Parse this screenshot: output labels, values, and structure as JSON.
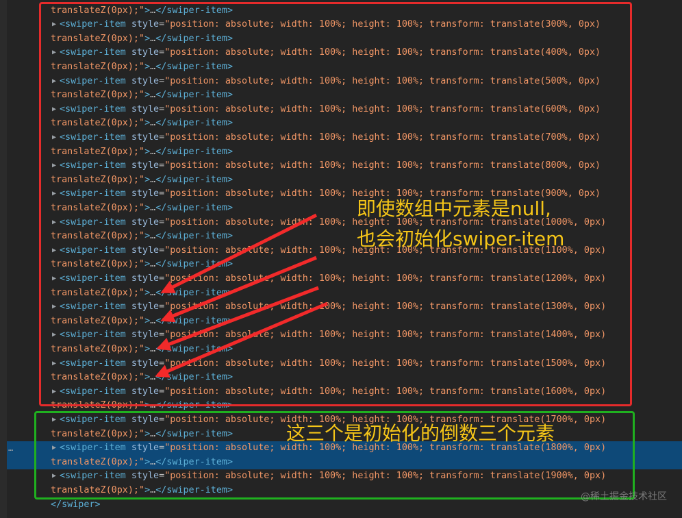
{
  "lines": [
    {
      "kind": "cont",
      "text": "translateZ(0px);\">…</swiper-item>"
    },
    {
      "kind": "open",
      "pct": "300%"
    },
    {
      "kind": "cont",
      "text": "translateZ(0px);\">…</swiper-item>"
    },
    {
      "kind": "open",
      "pct": "400%"
    },
    {
      "kind": "cont",
      "text": "translateZ(0px);\">…</swiper-item>"
    },
    {
      "kind": "open",
      "pct": "500%"
    },
    {
      "kind": "cont",
      "text": "translateZ(0px);\">…</swiper-item>"
    },
    {
      "kind": "open",
      "pct": "600%"
    },
    {
      "kind": "cont",
      "text": "translateZ(0px);\">…</swiper-item>"
    },
    {
      "kind": "open",
      "pct": "700%"
    },
    {
      "kind": "cont",
      "text": "translateZ(0px);\">…</swiper-item>"
    },
    {
      "kind": "open",
      "pct": "800%"
    },
    {
      "kind": "cont",
      "text": "translateZ(0px);\">…</swiper-item>"
    },
    {
      "kind": "open",
      "pct": "900%"
    },
    {
      "kind": "cont",
      "text": "translateZ(0px);\">…</swiper-item>"
    },
    {
      "kind": "open",
      "pct": "1000%"
    },
    {
      "kind": "cont",
      "text": "translateZ(0px);\">…</swiper-item>"
    },
    {
      "kind": "open",
      "pct": "1100%"
    },
    {
      "kind": "cont",
      "text": "translateZ(0px);\">…</swiper-item>"
    },
    {
      "kind": "open",
      "pct": "1200%"
    },
    {
      "kind": "cont",
      "text": "translateZ(0px);\">…</swiper-item>"
    },
    {
      "kind": "open",
      "pct": "1300%"
    },
    {
      "kind": "cont",
      "text": "translateZ(0px);\">…</swiper-item>"
    },
    {
      "kind": "open",
      "pct": "1400%"
    },
    {
      "kind": "cont",
      "text": "translateZ(0px);\">…</swiper-item>"
    },
    {
      "kind": "open",
      "pct": "1500%"
    },
    {
      "kind": "cont",
      "text": "translateZ(0px);\">…</swiper-item>"
    },
    {
      "kind": "open",
      "pct": "1600%"
    },
    {
      "kind": "cont",
      "text": "translateZ(0px);\">…</swiper-item>"
    },
    {
      "kind": "open",
      "pct": "1700%"
    },
    {
      "kind": "cont",
      "text": "translateZ(0px);\">…</swiper-item>"
    },
    {
      "kind": "open",
      "pct": "1800%",
      "selected": true
    },
    {
      "kind": "cont",
      "text": "translateZ(0px);\">…</swiper-item>",
      "selected": true
    },
    {
      "kind": "open",
      "pct": "1900%"
    },
    {
      "kind": "cont",
      "text": "translateZ(0px);\">…</swiper-item>"
    },
    {
      "kind": "close",
      "text": "</swiper>"
    }
  ],
  "tag_open": "<swiper-item",
  "attr_name": "style",
  "attr_eq": "=",
  "style_prefix": "\"position: absolute; width: 100%; height: 100%; transform: translate(",
  "style_suffix": ", 0px)",
  "selected_marker": "…",
  "annotations": {
    "red_note_line1": "即使数组中元素是null,",
    "red_note_line2": "也会初始化swiper-item",
    "green_note": "这三个是初始化的倒数三个元素"
  },
  "colors": {
    "red_box": "#e52b2b",
    "green_box": "#1fb01f",
    "note_text": "#f5c518",
    "selection": "#0e4978"
  },
  "watermark": "@稀土掘金技术社区"
}
